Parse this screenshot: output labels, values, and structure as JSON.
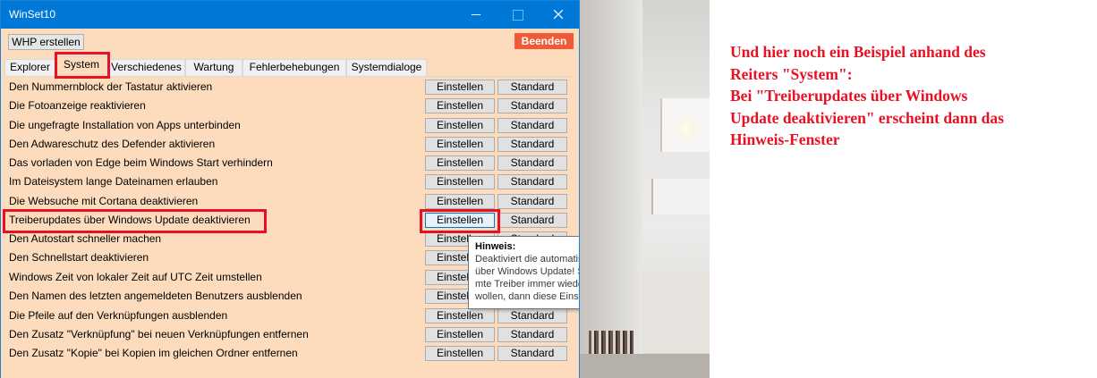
{
  "window": {
    "title": "WinSet10",
    "whp_label": "WHP erstellen",
    "quit_label": "Beenden",
    "tabs": [
      {
        "label": "Explorer",
        "active": false
      },
      {
        "label": "System",
        "active": true
      },
      {
        "label": "Verschiedenes",
        "active": false
      },
      {
        "label": "Wartung",
        "active": false
      },
      {
        "label": "Fehlerbehebungen",
        "active": false
      },
      {
        "label": "Systemdialoge",
        "active": false
      }
    ],
    "button_labels": {
      "set": "Einstellen",
      "default": "Standard"
    },
    "rows": [
      {
        "label": "Den Nummernblock der Tastatur aktivieren"
      },
      {
        "label": "Die Fotoanzeige reaktivieren"
      },
      {
        "label": "Die ungefragte Installation von Apps unterbinden"
      },
      {
        "label": "Den Adwareschutz des Defender aktivieren"
      },
      {
        "label": "Das vorladen von Edge beim Windows Start verhindern"
      },
      {
        "label": "Im Dateisystem lange Dateinamen erlauben"
      },
      {
        "label": "Die Websuche mit Cortana deaktivieren"
      },
      {
        "label": "Treiberupdates über Windows Update deaktivieren"
      },
      {
        "label": "Den Autostart schneller machen"
      },
      {
        "label": "Den Schnellstart deaktivieren"
      },
      {
        "label": "Windows Zeit von lokaler Zeit auf UTC Zeit umstellen"
      },
      {
        "label": "Den Namen des letzten angemeldeten Benutzers ausblenden"
      },
      {
        "label": "Die Pfeile auf den Verknüpfungen ausblenden"
      },
      {
        "label": "Den Zusatz \"Verknüpfung\" bei neuen Verknüpfungen entfernen"
      },
      {
        "label": "Den Zusatz \"Kopie\" bei Kopien im gleichen Ordner entfernen"
      }
    ],
    "tooltip": {
      "title": "Hinweis:",
      "lines": [
        "Deaktiviert die automatischen Treiberudates",
        "über Windows Update! Sollte Windows bestim-",
        "mte Treiber immer wieder selbstständig ersetzen",
        "wollen, dann diese Einstellung zu nutzen."
      ]
    }
  },
  "annotation": {
    "color": "#e81123",
    "lines": [
      "Und hier noch ein Beispiel anhand des",
      "Reiters \"System\":",
      "Bei \"Treiberupdates über Windows",
      "Update deaktivieren\" erscheint dann das",
      "Hinweis-Fenster"
    ]
  },
  "colors": {
    "titlebar": "#0078d7",
    "window_bg": "#fcdcbc",
    "quit_button": "#f05a37",
    "marker": "#e81123"
  },
  "icons": {
    "minimize": "minimize-icon",
    "maximize": "maximize-icon",
    "close": "close-icon"
  }
}
